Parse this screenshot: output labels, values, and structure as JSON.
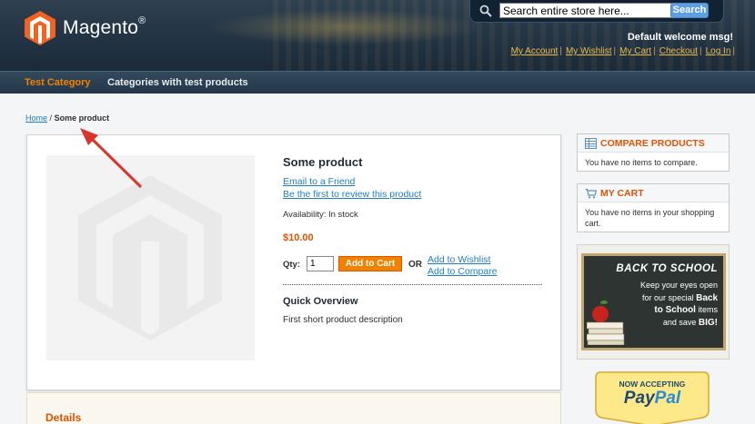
{
  "header": {
    "logo_text": "Magento",
    "logo_reg": "®",
    "search_placeholder": "Search entire store here...",
    "search_button": "Search",
    "welcome": "Default welcome msg!",
    "links": [
      "My Account",
      "My Wishlist",
      "My Cart",
      "Checkout",
      "Log In"
    ],
    "link_separator": "|"
  },
  "nav": {
    "active": "Test Category",
    "item2": "Categories with test products"
  },
  "breadcrumb": {
    "home": "Home",
    "separator": "/",
    "current": "Some product"
  },
  "product": {
    "name": "Some product",
    "email_friend": "Email to a Friend",
    "review": "Be the first to review this product",
    "availability": "Availability: In stock",
    "price": "$10.00",
    "qty_label": "Qty:",
    "qty_value": "1",
    "add_to_cart": "Add to Cart",
    "or": "OR",
    "add_wishlist": "Add to Wishlist",
    "add_compare": "Add to Compare",
    "overview_title": "Quick Overview",
    "overview_text": "First short product description",
    "details_title": "Details"
  },
  "sidebar": {
    "compare_title": "COMPARE PRODUCTS",
    "compare_text": "You have no items to compare.",
    "cart_title": "MY CART",
    "cart_text": "You have no items in your shopping cart.",
    "banner_title": "BACK TO SCHOOL",
    "banner_line1": "Keep your eyes open",
    "banner_line2": "for our special",
    "banner_bold1": "Back",
    "banner_bold2": "to School",
    "banner_line3": "items",
    "banner_line4": "and save",
    "banner_bold3": "BIG!",
    "paypal_now": "NOW ACCEPTING",
    "paypal_pay": "Pay",
    "paypal_pal": "Pal"
  },
  "colors": {
    "accent_orange": "#f18200",
    "link_blue": "#1e7ec8",
    "header_bg": "#223344",
    "annotation_arrow": "#d9362b"
  }
}
